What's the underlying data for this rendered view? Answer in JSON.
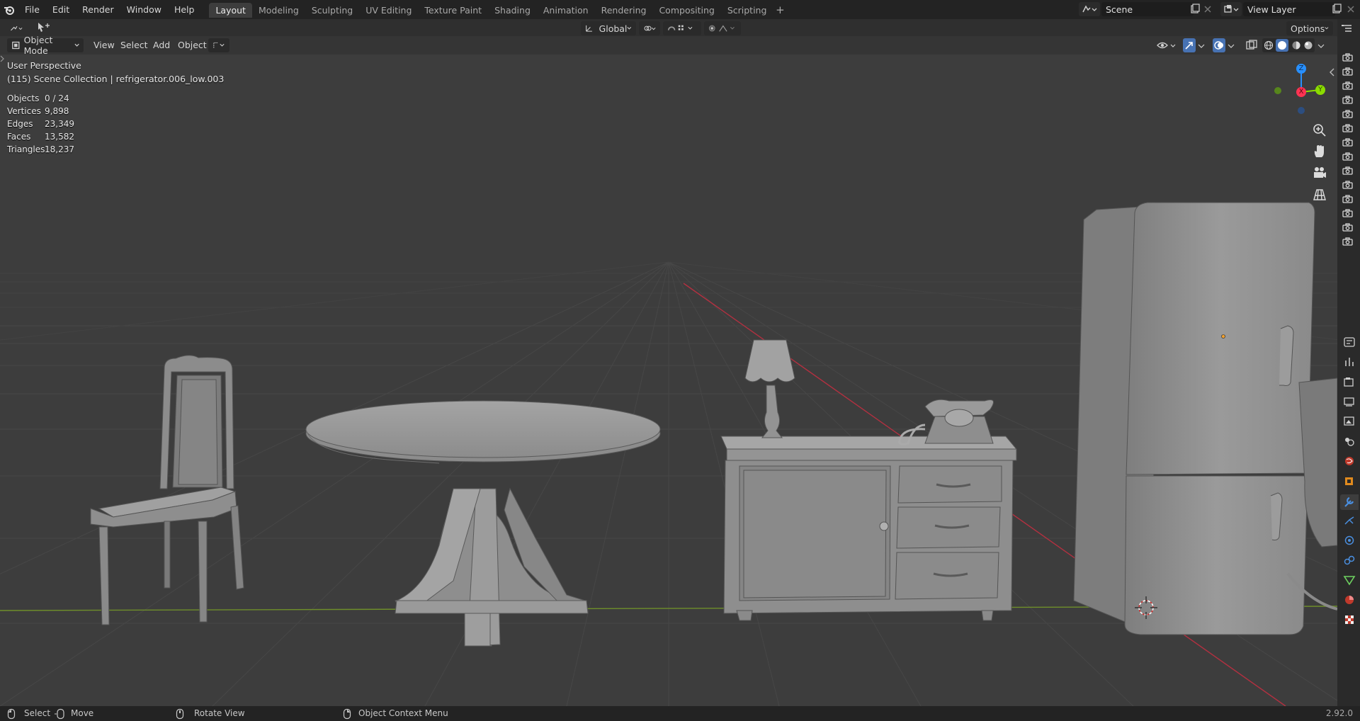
{
  "menu": {
    "items": [
      "File",
      "Edit",
      "Render",
      "Window",
      "Help"
    ]
  },
  "workspaces": {
    "tabs": [
      "Layout",
      "Modeling",
      "Sculpting",
      "UV Editing",
      "Texture Paint",
      "Shading",
      "Animation",
      "Rendering",
      "Compositing",
      "Scripting"
    ],
    "active": "Layout",
    "add_label": "+"
  },
  "scene": {
    "name": "Scene"
  },
  "view_layer": {
    "name": "View Layer"
  },
  "header": {
    "transform_orientation": "Global",
    "options_label": "Options",
    "mode": "Object Mode",
    "menus": [
      "View",
      "Select",
      "Add",
      "Object"
    ]
  },
  "viewport": {
    "perspective": "User Perspective",
    "collection_info": "(115) Scene Collection | refrigerator.006_low.003",
    "stats": [
      {
        "label": "Objects",
        "value": "0 / 24"
      },
      {
        "label": "Vertices",
        "value": "9,898"
      },
      {
        "label": "Edges",
        "value": "23,349"
      },
      {
        "label": "Faces",
        "value": "13,582"
      },
      {
        "label": "Triangles",
        "value": "18,237"
      }
    ],
    "gizmo": {
      "x": "X",
      "y": "Y",
      "z": "Z"
    }
  },
  "statusbar": {
    "select": "Select",
    "move": "Move",
    "rotate": "Rotate View",
    "context_menu": "Object Context Menu",
    "version": "2.92.0"
  },
  "colors": {
    "accent_blue": "#4772b3",
    "axis_x": "#ff3352",
    "axis_y": "#8bdc00",
    "axis_z": "#2890ff",
    "viewport_bg": "#3d3d3d"
  }
}
